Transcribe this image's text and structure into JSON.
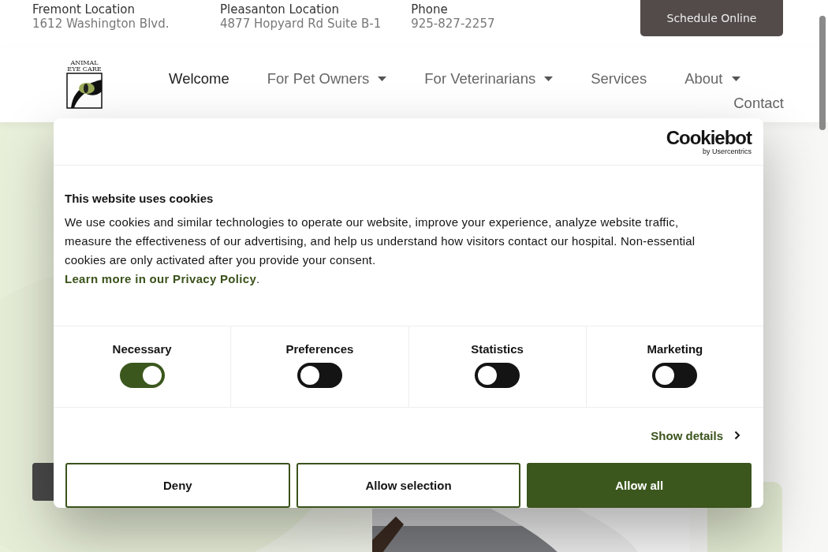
{
  "top_bar": {
    "locations": [
      {
        "label": "Fremont Location",
        "value": "1612 Washington Blvd."
      },
      {
        "label": "Pleasanton Location",
        "value": "4877 Hopyard Rd Suite B-1"
      },
      {
        "label": "Phone",
        "value": "925-827-2257"
      }
    ],
    "cta": "Schedule Online"
  },
  "nav": {
    "logo_lines": [
      "ANIMAL",
      "EYE CARE"
    ],
    "items": [
      {
        "label": "Welcome",
        "selected": true,
        "dropdown": false
      },
      {
        "label": "For Pet Owners",
        "selected": false,
        "dropdown": true
      },
      {
        "label": "For Veterinarians",
        "selected": false,
        "dropdown": true
      },
      {
        "label": "Services",
        "selected": false,
        "dropdown": false
      },
      {
        "label": "About",
        "selected": false,
        "dropdown": true
      },
      {
        "label": "Contact",
        "selected": false,
        "dropdown": false
      }
    ]
  },
  "cookie_dialog": {
    "brand": "Cookiebot",
    "brand_sub": "by Usercentrics",
    "title": "This website uses cookies",
    "body": "We use cookies and similar technologies to operate our website, improve your experience, analyze website traffic, measure the effectiveness of our advertising, and help us understand how visitors contact our hospital. Non-essential cookies are only activated after you provide your consent.",
    "link": "Learn more in our Privacy Policy",
    "link_end": ".",
    "categories": [
      {
        "label": "Necessary",
        "on": true
      },
      {
        "label": "Preferences",
        "on": false
      },
      {
        "label": "Statistics",
        "on": false
      },
      {
        "label": "Marketing",
        "on": false
      }
    ],
    "details": "Show details",
    "buttons": [
      {
        "label": "Deny",
        "kind": "outline"
      },
      {
        "label": "Allow selection",
        "kind": "outline"
      },
      {
        "label": "Allow all",
        "kind": "filled"
      }
    ]
  }
}
